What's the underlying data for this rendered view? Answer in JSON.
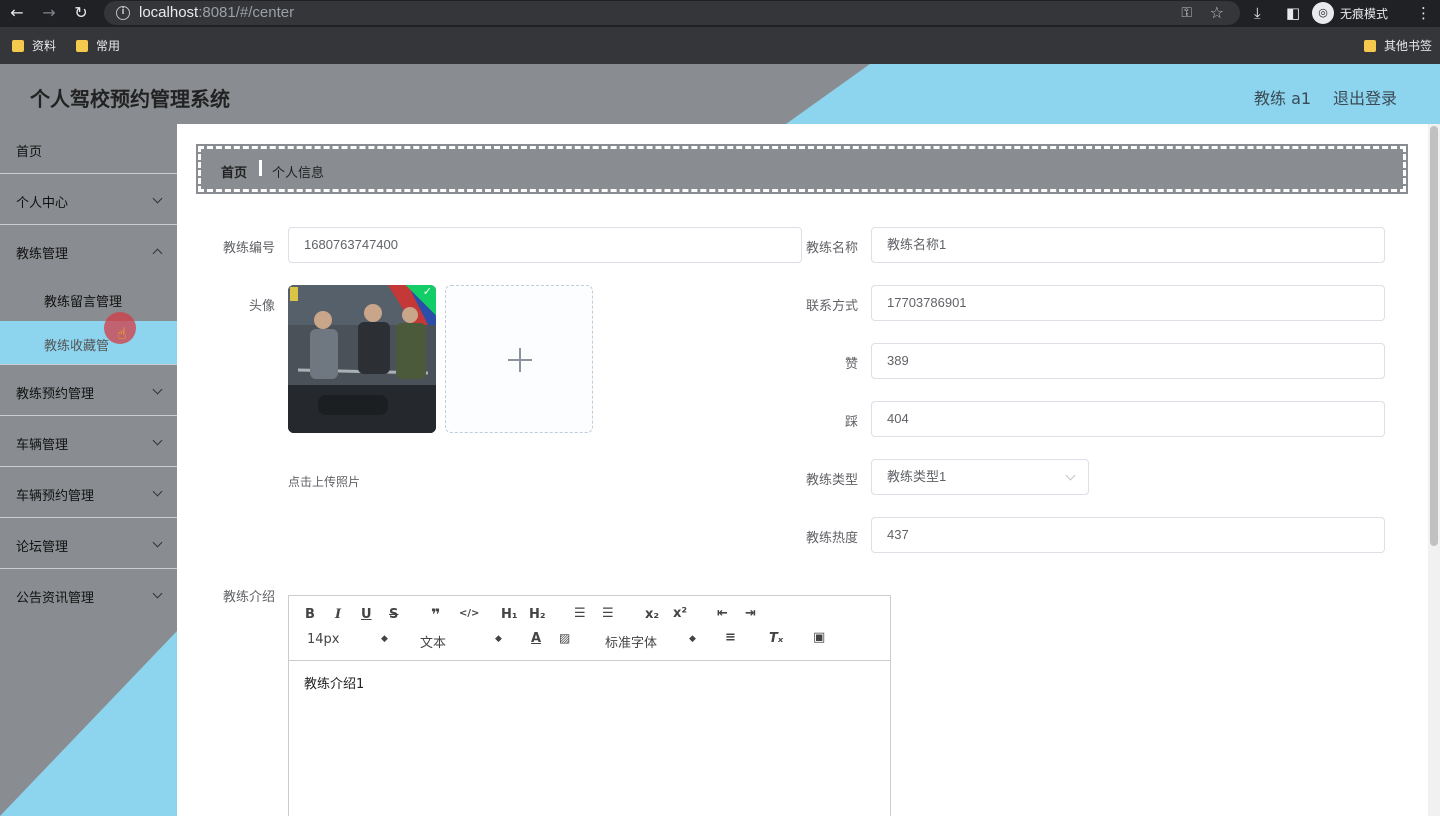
{
  "browser": {
    "url_host": "localhost",
    "url_port": ":8081/#/center",
    "incognito_label": "无痕模式",
    "bookmarks": [
      "资料",
      "常用"
    ],
    "other_bookmarks": "其他书签"
  },
  "header": {
    "title": "个人驾校预约管理系统",
    "user": "教练 a1",
    "logout": "退出登录"
  },
  "sidebar": {
    "items": [
      {
        "label": "首页"
      },
      {
        "label": "个人中心"
      },
      {
        "label": "教练管理"
      },
      {
        "label": "教练留言管理"
      },
      {
        "label": "教练收藏管"
      },
      {
        "label": "教练预约管理"
      },
      {
        "label": "车辆管理"
      },
      {
        "label": "车辆预约管理"
      },
      {
        "label": "论坛管理"
      },
      {
        "label": "公告资讯管理"
      }
    ]
  },
  "breadcrumb": {
    "home": "首页",
    "current": "个人信息"
  },
  "form": {
    "coach_no_label": "教练编号",
    "coach_no": "1680763747400",
    "coach_name_label": "教练名称",
    "coach_name": "教练名称1",
    "avatar_label": "头像",
    "upload_tip": "点击上传照片",
    "contact_label": "联系方式",
    "contact": "17703786901",
    "likes_label": "赞",
    "likes": "389",
    "dislikes_label": "踩",
    "dislikes": "404",
    "type_label": "教练类型",
    "type": "教练类型1",
    "heat_label": "教练热度",
    "heat": "437",
    "intro_label": "教练介绍",
    "intro": "教练介绍1"
  },
  "editor": {
    "font_size": "14px",
    "block_type": "文本",
    "font_family": "标准字体"
  }
}
